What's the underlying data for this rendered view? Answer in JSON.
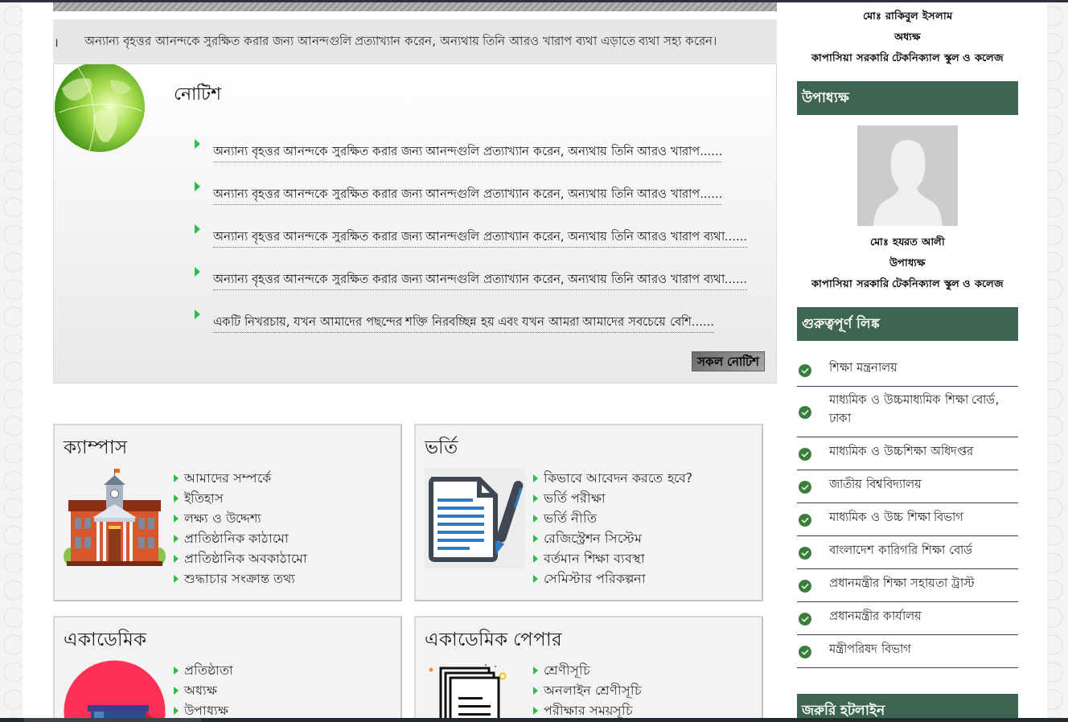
{
  "marquee": {
    "fragment": "।",
    "text": "অন্যান্য বৃহত্তর আনন্দকে সুরক্ষিত করার জন্য আনন্দগুলি প্রত্যাখ্যান করেন, অন্যথায় তিনি আরও খারাপ ব্যথা এড়াতে ব্যথা সহ্য করেন।"
  },
  "notice": {
    "title": "নোটিশ",
    "items": [
      "অন্যান্য বৃহত্তর আনন্দকে সুরক্ষিত করার জন্য আনন্দগুলি প্রত্যাখ্যান করেন, অন্যথায় তিনি আরও খারাপ......",
      "অন্যান্য বৃহত্তর আনন্দকে সুরক্ষিত করার জন্য আনন্দগুলি প্রত্যাখ্যান করেন, অন্যথায় তিনি আরও খারাপ......",
      "অন্যান্য বৃহত্তর আনন্দকে সুরক্ষিত করার জন্য আনন্দগুলি প্রত্যাখ্যান করেন, অন্যথায় তিনি আরও খারাপ ব্যথা......",
      "অন্যান্য বৃহত্তর আনন্দকে সুরক্ষিত করার জন্য আনন্দগুলি প্রত্যাখ্যান করেন, অন্যথায় তিনি আরও খারাপ ব্যথা......",
      "একটি নিখরচায়, যখন আমাদের পছন্দের শক্তি নিরবচ্ছিন্ন হয় এবং যখন আমরা আমাদের সবচেয়ে বেশি......"
    ],
    "button": "সকল নোটিশ"
  },
  "cards": [
    {
      "title": "ক্যাম্পাস",
      "kind": "building",
      "links": [
        "আমাদের সম্পর্কে",
        "ইতিহাস",
        "লক্ষ্য ও উদ্দেশ্য",
        "প্রাতিষ্ঠানিক কাঠামো",
        "প্রাতিষ্ঠানিক অবকাঠামো",
        "শুদ্ধাচার সংক্রান্ত তথ্য"
      ]
    },
    {
      "title": "ভর্তি",
      "kind": "document",
      "links": [
        "কিভাবে আবেদন করতে হবে?",
        "ভর্তি পরীক্ষা",
        "ভর্তি নীতি",
        "রেজিস্ট্রেশন সিস্টেম",
        "বর্তমান শিক্ষা ব্যবস্থা",
        "সেমিস্টার পরিকল্পনা"
      ]
    },
    {
      "title": "একাডেমিক",
      "kind": "books",
      "links": [
        "প্রতিষ্ঠাতা",
        "অধ্যক্ষ",
        "উপাধ্যক্ষ"
      ]
    },
    {
      "title": "একাডেমিক পেপার",
      "kind": "papers",
      "links": [
        "শ্রেণীসূচি",
        "অনলাইন শ্রেণীসূচি",
        "পরীক্ষার সময়সূচি"
      ]
    }
  ],
  "sidebar": {
    "principal": {
      "name": "মোঃ রাকিবুল ইসলাম",
      "role": "অধ্যক্ষ",
      "institution": "কাপাসিয়া সরকারি টেকনিক্যাল স্কুল ও কলেজ"
    },
    "vice_principal": {
      "heading": "উপাধ্যক্ষ",
      "name": "মোঃ হযরত আলী",
      "role": "উপাধ্যক্ষ",
      "institution": "কাপাসিয়া সরকারি টেকনিক্যাল স্কুল ও কলেজ"
    },
    "links": {
      "heading": "গুরুত্বপূর্ণ লিঙ্ক",
      "items": [
        "শিক্ষা মন্ত্রনালয়",
        "মাধ্যমিক ও উচ্চমাধ্যমিক শিক্ষা বোর্ড, ঢাকা",
        "মাধ্যমিক ও উচ্চশিক্ষা অধিদপ্তর",
        "জাতীয় বিশ্ববিদ্যালয়",
        "মাধ্যমিক ও উচ্চ শিক্ষা বিভাগ",
        "বাংলাদেশ কারিগরি শিক্ষা বোর্ড",
        "প্রধানমন্ত্রীর শিক্ষা সহায়তা ট্রাস্ট",
        "প্রধানমন্ত্রীর কার্যালয়",
        "মন্ত্রীপরিষদ বিভাগ"
      ]
    },
    "hotline": {
      "heading": "জরুরি হটলাইন"
    }
  }
}
